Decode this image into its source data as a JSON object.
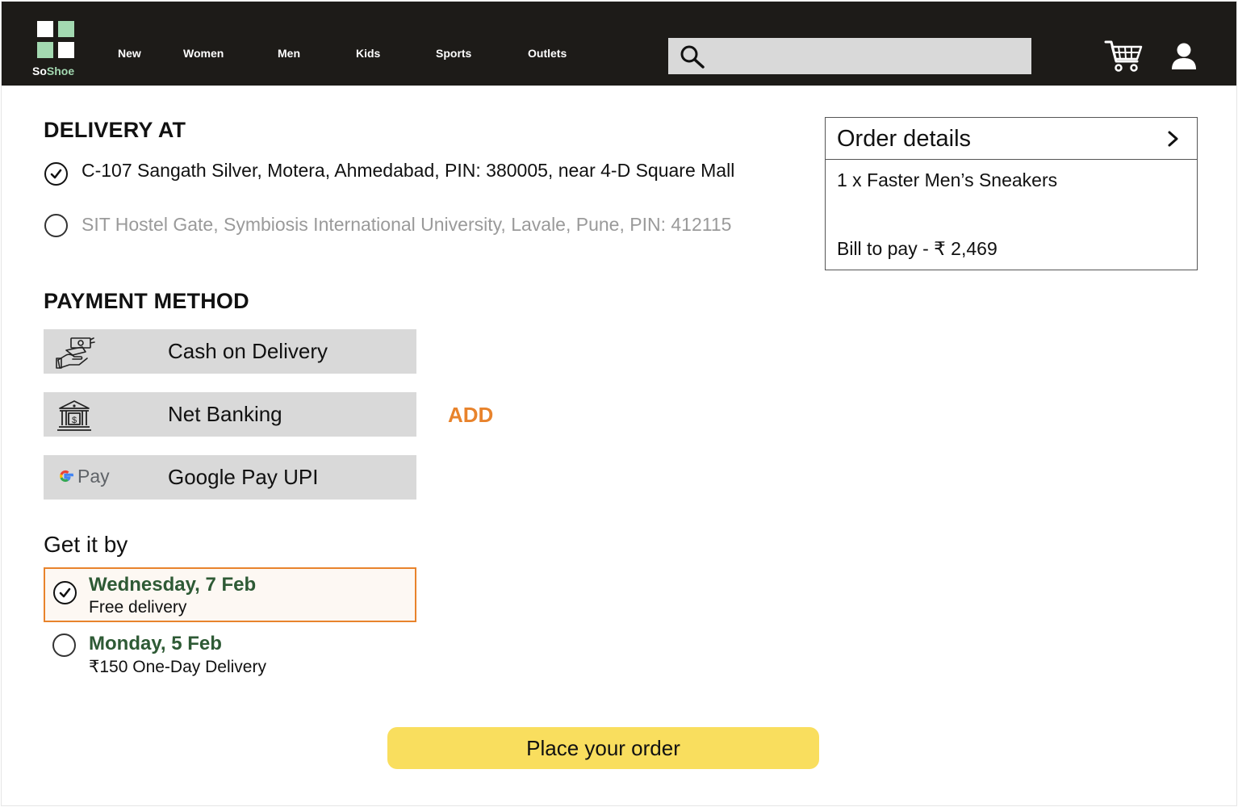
{
  "header": {
    "brand_prefix": "So",
    "brand_suffix": "Shoe",
    "nav": [
      "New",
      "Women",
      "Men",
      "Kids",
      "Sports",
      "Outlets"
    ],
    "search": {
      "value": "",
      "placeholder": ""
    },
    "icons": [
      "search-icon",
      "cart-icon",
      "user-icon"
    ]
  },
  "delivery": {
    "title": "DELIVERY AT",
    "addresses": [
      {
        "text": "C-107 Sangath Silver, Motera, Ahmedabad, PIN: 380005, near 4-D Square Mall",
        "selected": true
      },
      {
        "text": "SIT Hostel Gate, Symbiosis International University, Lavale, Pune, PIN: 412115",
        "selected": false
      }
    ]
  },
  "payment": {
    "title": "PAYMENT METHOD",
    "methods": [
      {
        "label": "Cash on Delivery",
        "icon": "cash-hand-icon"
      },
      {
        "label": "Net Banking",
        "icon": "bank-icon"
      },
      {
        "label": "Google Pay UPI",
        "icon": "gpay-logo",
        "icon_text": "Pay"
      }
    ],
    "add_label": "ADD"
  },
  "get_it_by": {
    "title": "Get it by",
    "options": [
      {
        "date": "Wednesday, 7 Feb",
        "desc": "Free delivery",
        "selected": true
      },
      {
        "date": "Monday, 5 Feb",
        "desc": "₹150 One-Day Delivery",
        "selected": false
      }
    ]
  },
  "order": {
    "title": "Order details",
    "item": "1 x Faster Men’s Sneakers",
    "bill": "Bill to pay - ₹ 2,469"
  },
  "place_order_label": "Place your order",
  "colors": {
    "header_bg": "#1d1b18",
    "logo_green": "#a3d9b1",
    "accent_orange": "#e8832c",
    "date_green": "#2e5a35",
    "button_yellow": "#f9de5e",
    "row_gray": "#d9d9d9"
  }
}
